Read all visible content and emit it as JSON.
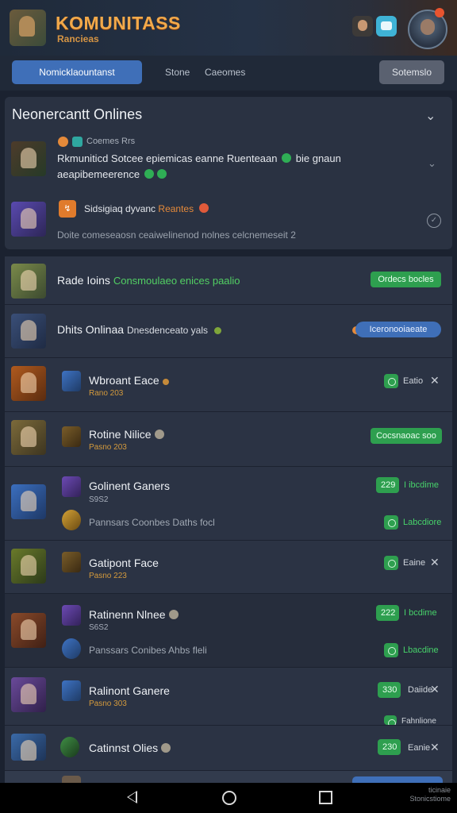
{
  "header": {
    "title": "KOMUNITASS",
    "subtitle": "Rancieas"
  },
  "tabs": {
    "active": "Nomicklaountanst",
    "items": [
      "Stone",
      "Caeomes"
    ],
    "button": "Sotemslo"
  },
  "online": {
    "title": "Neonercantt Onlines",
    "feed": [
      {
        "meta": "Coemes Rrs",
        "text": "Rkmuniticd Sotcee epiemicas eanne Ruenteaan",
        "text_tail": "bie gnaun",
        "line2": "aeapibemeerence"
      },
      {
        "meta": "Sidsigiaq dyvanc",
        "meta_tag": "Reantes",
        "line2": "Doite comeseaosn ceaiwelinenod nolnes celcnemeseit",
        "line2_tail": "2"
      }
    ]
  },
  "rows": [
    {
      "title": "Rade Ioins",
      "highlight": "Consmoulaeo enices paalio",
      "pill": "Ordecs bocles"
    },
    {
      "title": "Dhits Onlinaa",
      "desc": "Dnesdenceato yals",
      "pill": "Iceronooiaeate"
    },
    {
      "title": "Wbroant Eace",
      "sub": "Rano 203",
      "status": "Eatio"
    },
    {
      "title": "Rotine Nilice",
      "sub": "Pasno 203",
      "pill": "Cocsnaoac soo"
    },
    {
      "title": "Golinent Ganers",
      "sub": "S9S2",
      "desc": "Pannsars Coonbes Daths focl",
      "pill": "229",
      "status": "I ibcdime",
      "status2": "Labcdiore"
    },
    {
      "title": "Gatipont Face",
      "sub": "Pasno 223",
      "status": "Eaine"
    },
    {
      "title": "Ratinenn Nlnee",
      "sub": "S6S2",
      "desc": "Panssars Conibes Ahbs fleli",
      "pill": "222",
      "status": "I bcdime",
      "status2": "Lbacdine"
    },
    {
      "title": "Ralinont Ganere",
      "sub": "Pasno 303",
      "pill": "330",
      "status": "Daiide",
      "status2": "Fahnlione"
    },
    {
      "title": "Catinnst Olies",
      "pill": "230",
      "status": "Eanie"
    }
  ],
  "navbar": {
    "meta_line1": "ticinaie",
    "meta_line2": "Stonicstiome"
  },
  "icons": {
    "collapse": "chevron-down-icon",
    "close": "close-icon",
    "back": "back-icon",
    "home": "home-icon",
    "recent": "recent-apps-icon"
  },
  "colors": {
    "accent_blue": "#3f6fb8",
    "accent_green": "#2e9f4f",
    "accent_orange": "#e58a3a",
    "title_gold": "#f2a94a"
  }
}
